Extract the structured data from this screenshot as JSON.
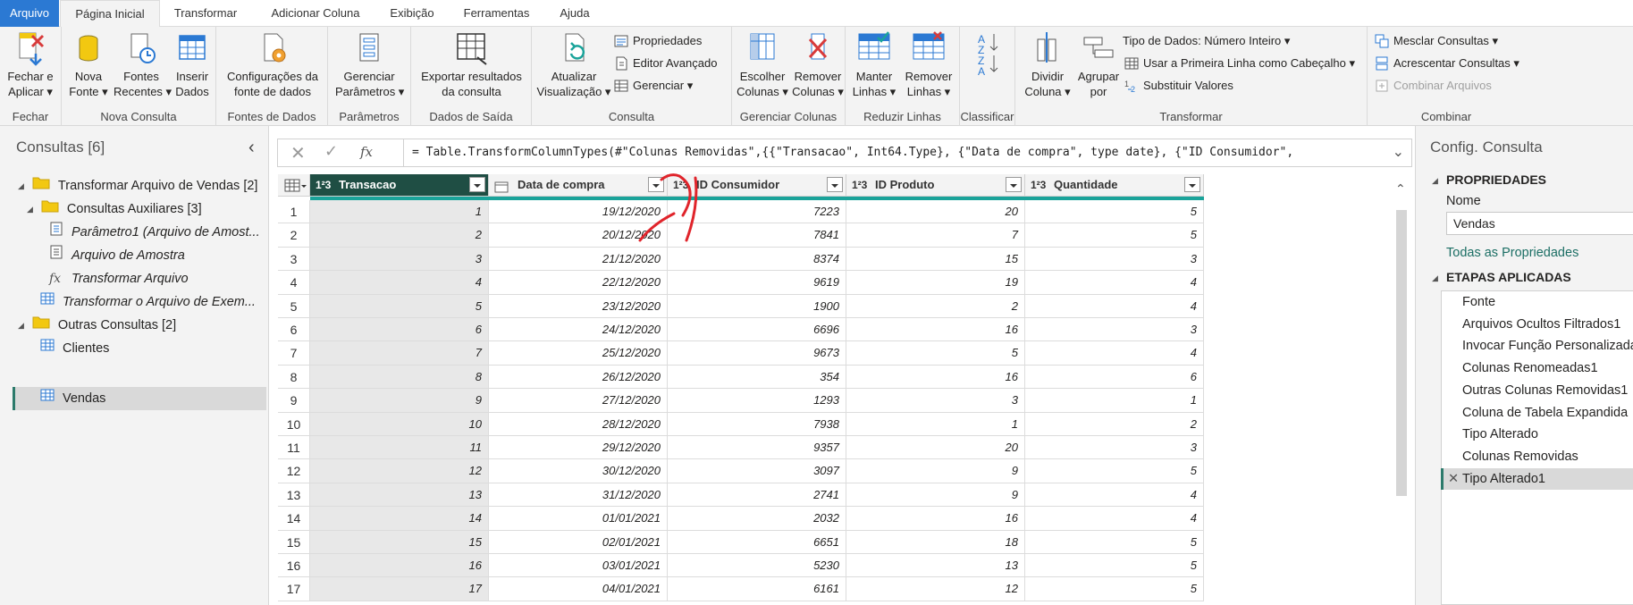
{
  "tabs": [
    "Arquivo",
    "Página Inicial",
    "Transformar",
    "Adicionar Coluna",
    "Exibição",
    "Ferramentas",
    "Ajuda"
  ],
  "ribbon": {
    "close_btn": [
      "Fechar e",
      "Aplicar ▾"
    ],
    "new_source": [
      "Nova",
      "Fonte ▾"
    ],
    "recent_sources": [
      "Fontes",
      "Recentes ▾"
    ],
    "enter_data": [
      "Inserir",
      "Dados"
    ],
    "source_settings": [
      "Configurações da",
      "fonte de dados"
    ],
    "manage_params": [
      "Gerenciar",
      "Parâmetros ▾"
    ],
    "export_results": [
      "Exportar resultados",
      "da consulta"
    ],
    "refresh": [
      "Atualizar",
      "Visualização ▾"
    ],
    "properties": "Propriedades",
    "advanced_editor": "Editor Avançado",
    "manage": "Gerenciar ▾",
    "choose_cols": [
      "Escolher",
      "Colunas ▾"
    ],
    "remove_cols": [
      "Remover",
      "Colunas ▾"
    ],
    "keep_rows": [
      "Manter",
      "Linhas ▾"
    ],
    "remove_rows": [
      "Remover",
      "Linhas ▾"
    ],
    "split_col": [
      "Dividir",
      "Coluna ▾"
    ],
    "group_by": [
      "Agrupar",
      "por"
    ],
    "data_type": "Tipo de Dados: Número Inteiro ▾",
    "first_row_header": "Usar a Primeira Linha como Cabeçalho ▾",
    "replace_values": "Substituir Valores",
    "merge_queries": "Mesclar Consultas ▾",
    "append_queries": "Acrescentar Consultas ▾",
    "combine_files": "Combinar Arquivos",
    "groups": [
      "Fechar",
      "Nova Consulta",
      "Fontes de Dados",
      "Parâmetros",
      "Dados de Saída",
      "Consulta",
      "Gerenciar Colunas",
      "Reduzir Linhas",
      "Classificar",
      "Transformar",
      "Combinar"
    ]
  },
  "queries": {
    "title": "Consultas [6]",
    "items": [
      {
        "label": "Transformar Arquivo de Vendas [2]"
      },
      {
        "label": "Consultas Auxiliares [3]"
      },
      {
        "label": "Parâmetro1 (Arquivo de Amost..."
      },
      {
        "label": "Arquivo de Amostra"
      },
      {
        "label": "Transformar Arquivo"
      },
      {
        "label": "Transformar o Arquivo de Exem..."
      },
      {
        "label": "Outras Consultas [2]"
      },
      {
        "label": "Clientes"
      },
      {
        "label": "Vendas"
      }
    ]
  },
  "formula": {
    "text": "= Table.TransformColumnTypes(#\"Colunas Removidas\",{{\"Transacao\", Int64.Type}, {\"Data de compra\", type date}, {\"ID Consumidor\","
  },
  "table": {
    "columns": [
      {
        "type": "1²3",
        "name": "Transacao"
      },
      {
        "type": "date",
        "name": "Data de compra"
      },
      {
        "type": "1²3",
        "name": "ID Consumidor"
      },
      {
        "type": "1²3",
        "name": "ID Produto"
      },
      {
        "type": "1²3",
        "name": "Quantidade"
      }
    ],
    "rows": [
      [
        "1",
        "1",
        "19/12/2020",
        "7223",
        "20",
        "5"
      ],
      [
        "2",
        "2",
        "20/12/2020",
        "7841",
        "7",
        "5"
      ],
      [
        "3",
        "3",
        "21/12/2020",
        "8374",
        "15",
        "3"
      ],
      [
        "4",
        "4",
        "22/12/2020",
        "9619",
        "19",
        "4"
      ],
      [
        "5",
        "5",
        "23/12/2020",
        "1900",
        "2",
        "4"
      ],
      [
        "6",
        "6",
        "24/12/2020",
        "6696",
        "16",
        "3"
      ],
      [
        "7",
        "7",
        "25/12/2020",
        "9673",
        "5",
        "4"
      ],
      [
        "8",
        "8",
        "26/12/2020",
        "354",
        "16",
        "6"
      ],
      [
        "9",
        "9",
        "27/12/2020",
        "1293",
        "3",
        "1"
      ],
      [
        "10",
        "10",
        "28/12/2020",
        "7938",
        "1",
        "2"
      ],
      [
        "11",
        "11",
        "29/12/2020",
        "9357",
        "20",
        "3"
      ],
      [
        "12",
        "12",
        "30/12/2020",
        "3097",
        "9",
        "5"
      ],
      [
        "13",
        "13",
        "31/12/2020",
        "2741",
        "9",
        "4"
      ],
      [
        "14",
        "14",
        "01/01/2021",
        "2032",
        "16",
        "4"
      ],
      [
        "15",
        "15",
        "02/01/2021",
        "6651",
        "18",
        "5"
      ],
      [
        "16",
        "16",
        "03/01/2021",
        "5230",
        "13",
        "5"
      ],
      [
        "17",
        "17",
        "04/01/2021",
        "6161",
        "12",
        "5"
      ]
    ]
  },
  "settings": {
    "title": "Config. Consulta",
    "properties_header": "PROPRIEDADES",
    "name_label": "Nome",
    "name_value": "Vendas",
    "all_props": "Todas as Propriedades",
    "steps_header": "ETAPAS APLICADAS",
    "steps": [
      "Fonte",
      "Arquivos Ocultos Filtrados1",
      "Invocar Função Personalizada",
      "Colunas Renomeadas1",
      "Outras Colunas Removidas1",
      "Coluna de Tabela Expandida",
      "Tipo Alterado",
      "Colunas Removidas",
      "Tipo Alterado1"
    ]
  },
  "colors": {
    "accent": "#2b79d3",
    "selected_header": "#1f4e44",
    "teal": "#1aa39a",
    "annotation": "#e0242b"
  }
}
